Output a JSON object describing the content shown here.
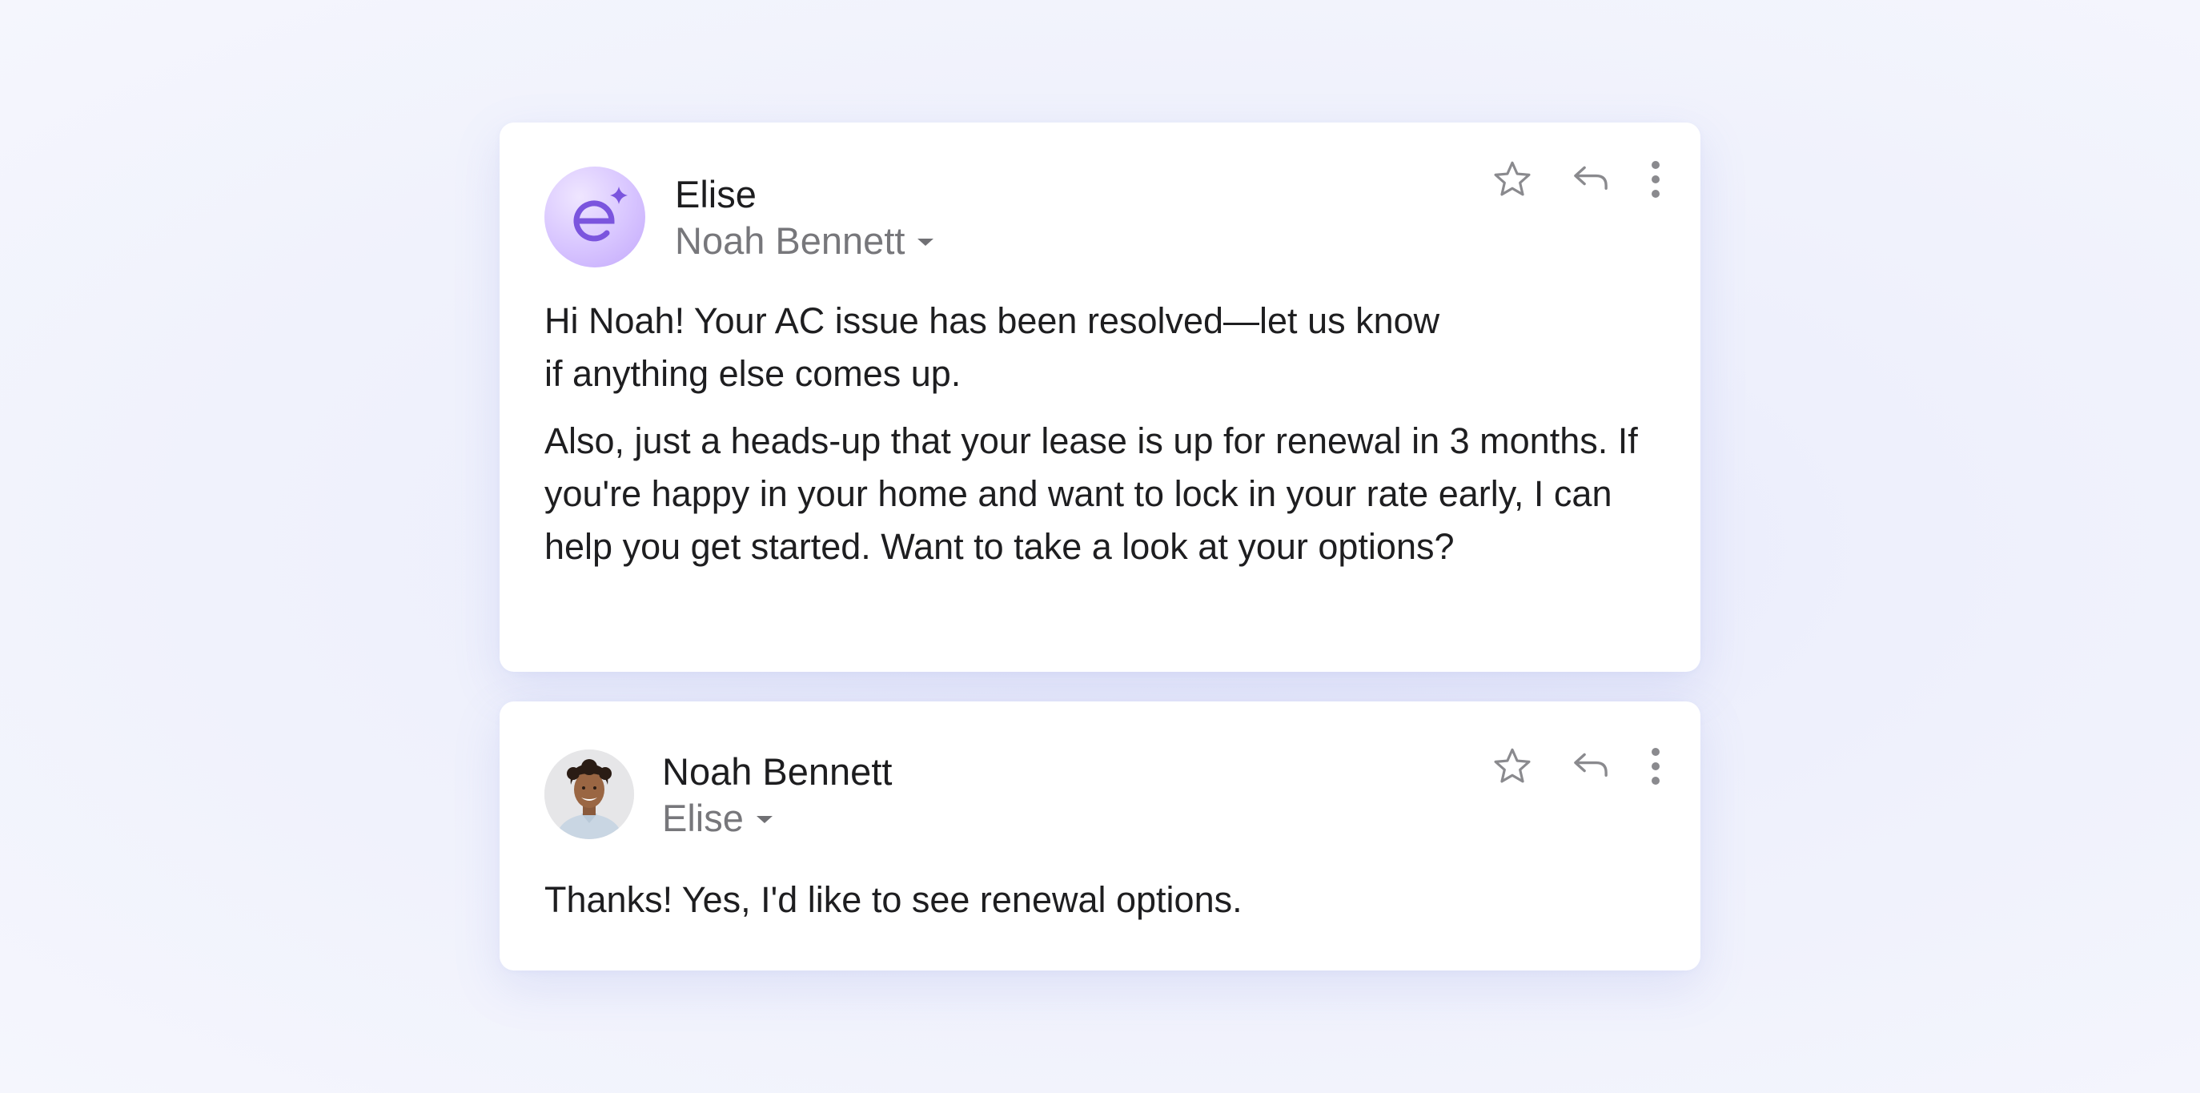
{
  "thread": {
    "messages": [
      {
        "sender": "Elise",
        "recipient": "Noah Bennett",
        "avatar_icon": "elise-ai-logo-icon",
        "avatar_color": "#7b55de",
        "body": [
          "Hi Noah! Your AC issue has been resolved—let us know\nif anything else comes up.",
          "Also, just a heads-up that your lease is up for renewal in 3 months. If you're happy in your home and want to lock in your rate early, I can help you get started. Want to take a look at your options?"
        ],
        "actions": [
          "star-icon",
          "reply-icon",
          "more-vertical-icon"
        ]
      },
      {
        "sender": "Noah Bennett",
        "recipient": "Elise",
        "avatar_icon": "user-photo-avatar",
        "body": [
          "Thanks! Yes, I'd like to see renewal options."
        ],
        "actions": [
          "star-icon",
          "reply-icon",
          "more-vertical-icon"
        ]
      }
    ]
  },
  "colors": {
    "icon_gray": "#8a8a8e",
    "accent_purple": "#7b55de"
  }
}
